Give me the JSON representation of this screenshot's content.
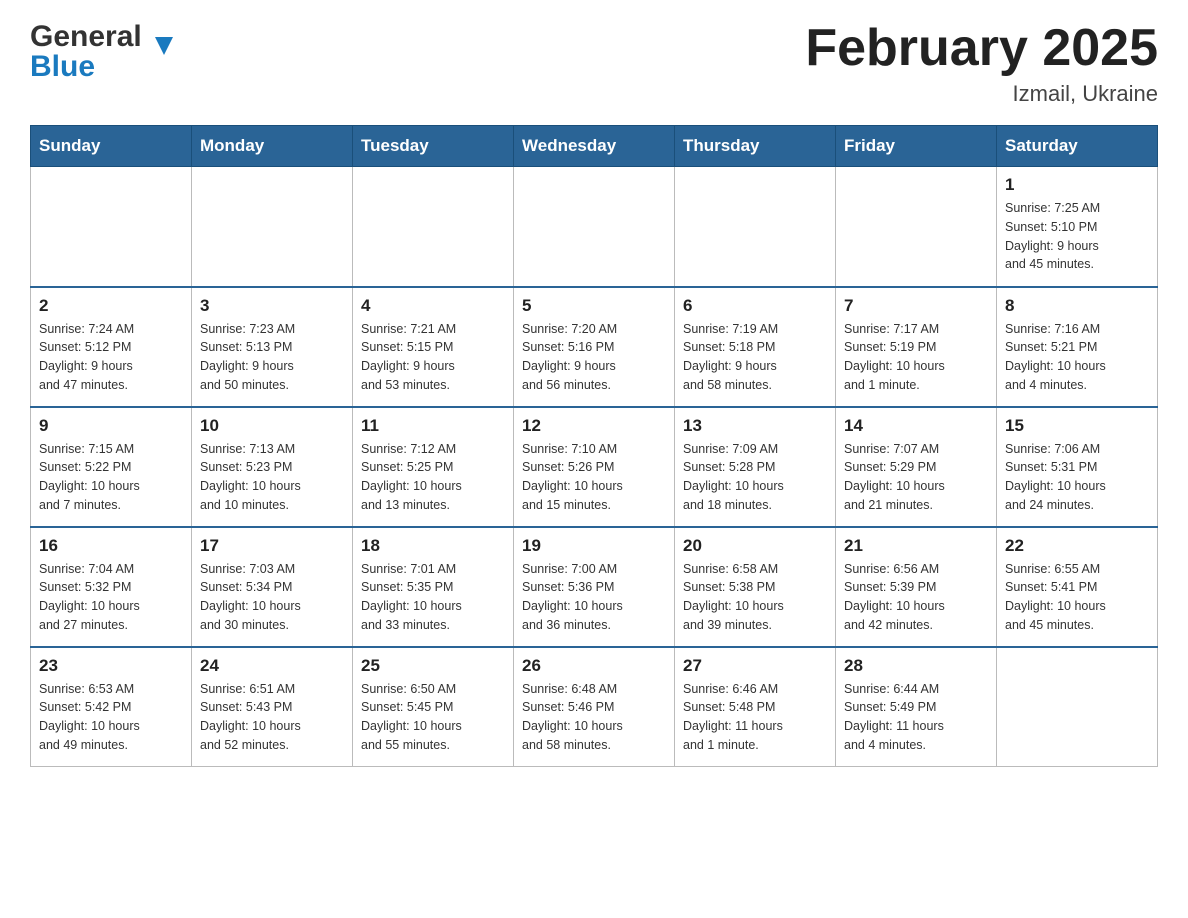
{
  "logo": {
    "line1": "General",
    "arrow": "▲",
    "line2": "Blue"
  },
  "title": "February 2025",
  "subtitle": "Izmail, Ukraine",
  "days_of_week": [
    "Sunday",
    "Monday",
    "Tuesday",
    "Wednesday",
    "Thursday",
    "Friday",
    "Saturday"
  ],
  "weeks": [
    [
      {
        "day": "",
        "info": ""
      },
      {
        "day": "",
        "info": ""
      },
      {
        "day": "",
        "info": ""
      },
      {
        "day": "",
        "info": ""
      },
      {
        "day": "",
        "info": ""
      },
      {
        "day": "",
        "info": ""
      },
      {
        "day": "1",
        "info": "Sunrise: 7:25 AM\nSunset: 5:10 PM\nDaylight: 9 hours\nand 45 minutes."
      }
    ],
    [
      {
        "day": "2",
        "info": "Sunrise: 7:24 AM\nSunset: 5:12 PM\nDaylight: 9 hours\nand 47 minutes."
      },
      {
        "day": "3",
        "info": "Sunrise: 7:23 AM\nSunset: 5:13 PM\nDaylight: 9 hours\nand 50 minutes."
      },
      {
        "day": "4",
        "info": "Sunrise: 7:21 AM\nSunset: 5:15 PM\nDaylight: 9 hours\nand 53 minutes."
      },
      {
        "day": "5",
        "info": "Sunrise: 7:20 AM\nSunset: 5:16 PM\nDaylight: 9 hours\nand 56 minutes."
      },
      {
        "day": "6",
        "info": "Sunrise: 7:19 AM\nSunset: 5:18 PM\nDaylight: 9 hours\nand 58 minutes."
      },
      {
        "day": "7",
        "info": "Sunrise: 7:17 AM\nSunset: 5:19 PM\nDaylight: 10 hours\nand 1 minute."
      },
      {
        "day": "8",
        "info": "Sunrise: 7:16 AM\nSunset: 5:21 PM\nDaylight: 10 hours\nand 4 minutes."
      }
    ],
    [
      {
        "day": "9",
        "info": "Sunrise: 7:15 AM\nSunset: 5:22 PM\nDaylight: 10 hours\nand 7 minutes."
      },
      {
        "day": "10",
        "info": "Sunrise: 7:13 AM\nSunset: 5:23 PM\nDaylight: 10 hours\nand 10 minutes."
      },
      {
        "day": "11",
        "info": "Sunrise: 7:12 AM\nSunset: 5:25 PM\nDaylight: 10 hours\nand 13 minutes."
      },
      {
        "day": "12",
        "info": "Sunrise: 7:10 AM\nSunset: 5:26 PM\nDaylight: 10 hours\nand 15 minutes."
      },
      {
        "day": "13",
        "info": "Sunrise: 7:09 AM\nSunset: 5:28 PM\nDaylight: 10 hours\nand 18 minutes."
      },
      {
        "day": "14",
        "info": "Sunrise: 7:07 AM\nSunset: 5:29 PM\nDaylight: 10 hours\nand 21 minutes."
      },
      {
        "day": "15",
        "info": "Sunrise: 7:06 AM\nSunset: 5:31 PM\nDaylight: 10 hours\nand 24 minutes."
      }
    ],
    [
      {
        "day": "16",
        "info": "Sunrise: 7:04 AM\nSunset: 5:32 PM\nDaylight: 10 hours\nand 27 minutes."
      },
      {
        "day": "17",
        "info": "Sunrise: 7:03 AM\nSunset: 5:34 PM\nDaylight: 10 hours\nand 30 minutes."
      },
      {
        "day": "18",
        "info": "Sunrise: 7:01 AM\nSunset: 5:35 PM\nDaylight: 10 hours\nand 33 minutes."
      },
      {
        "day": "19",
        "info": "Sunrise: 7:00 AM\nSunset: 5:36 PM\nDaylight: 10 hours\nand 36 minutes."
      },
      {
        "day": "20",
        "info": "Sunrise: 6:58 AM\nSunset: 5:38 PM\nDaylight: 10 hours\nand 39 minutes."
      },
      {
        "day": "21",
        "info": "Sunrise: 6:56 AM\nSunset: 5:39 PM\nDaylight: 10 hours\nand 42 minutes."
      },
      {
        "day": "22",
        "info": "Sunrise: 6:55 AM\nSunset: 5:41 PM\nDaylight: 10 hours\nand 45 minutes."
      }
    ],
    [
      {
        "day": "23",
        "info": "Sunrise: 6:53 AM\nSunset: 5:42 PM\nDaylight: 10 hours\nand 49 minutes."
      },
      {
        "day": "24",
        "info": "Sunrise: 6:51 AM\nSunset: 5:43 PM\nDaylight: 10 hours\nand 52 minutes."
      },
      {
        "day": "25",
        "info": "Sunrise: 6:50 AM\nSunset: 5:45 PM\nDaylight: 10 hours\nand 55 minutes."
      },
      {
        "day": "26",
        "info": "Sunrise: 6:48 AM\nSunset: 5:46 PM\nDaylight: 10 hours\nand 58 minutes."
      },
      {
        "day": "27",
        "info": "Sunrise: 6:46 AM\nSunset: 5:48 PM\nDaylight: 11 hours\nand 1 minute."
      },
      {
        "day": "28",
        "info": "Sunrise: 6:44 AM\nSunset: 5:49 PM\nDaylight: 11 hours\nand 4 minutes."
      },
      {
        "day": "",
        "info": ""
      }
    ]
  ]
}
